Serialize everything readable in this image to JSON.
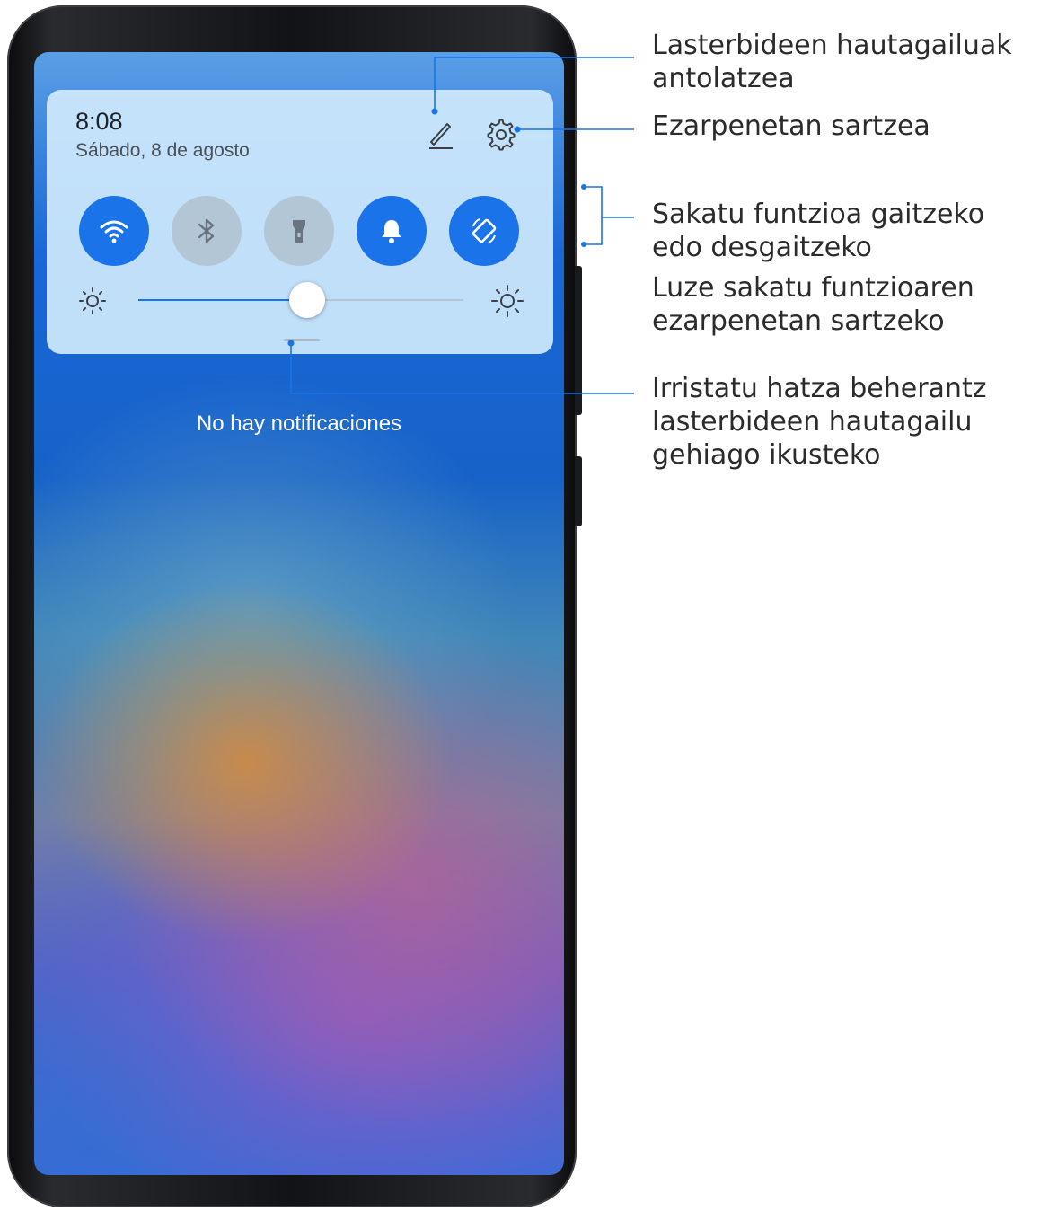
{
  "status": {
    "time": "8:08",
    "date": "Sábado, 8 de agosto"
  },
  "header_icons": [
    {
      "name": "edit-icon",
      "interactable": true
    },
    {
      "name": "gear-icon",
      "interactable": true
    }
  ],
  "toggles": [
    {
      "name": "wifi",
      "icon": "wifi-icon",
      "state": "on"
    },
    {
      "name": "bluetooth",
      "icon": "bluetooth-icon",
      "state": "off"
    },
    {
      "name": "flashlight",
      "icon": "flashlight-icon",
      "state": "off"
    },
    {
      "name": "sound",
      "icon": "bell-icon",
      "state": "on"
    },
    {
      "name": "auto-rotate",
      "icon": "rotate-icon",
      "state": "on"
    }
  ],
  "brightness": {
    "level": 0.52,
    "low_icon": "sun-small-icon",
    "high_icon": "sun-large-icon"
  },
  "notifications": {
    "empty_text": "No hay notificaciones"
  },
  "callouts": {
    "edit_line1": "Lasterbideen hautagailuak",
    "edit_line2": "antolatzea",
    "settings": "Ezarpenetan sartzea",
    "tap_line1": "Sakatu funtzioa gaitzeko",
    "tap_line2": "edo desgaitzeko",
    "long_line1": "Luze sakatu funtzioaren",
    "long_line2": "ezarpenetan sartzeko",
    "swipe_line1": "Irristatu hatza beherantz",
    "swipe_line2": "lasterbideen hautagailu",
    "swipe_line3": "gehiago ikusteko"
  },
  "colors": {
    "accent": "#1a73e8",
    "toggle_off": "#b2c6d6",
    "callout_line": "#1a73e8",
    "panel_bg": "#cfe9fc"
  }
}
